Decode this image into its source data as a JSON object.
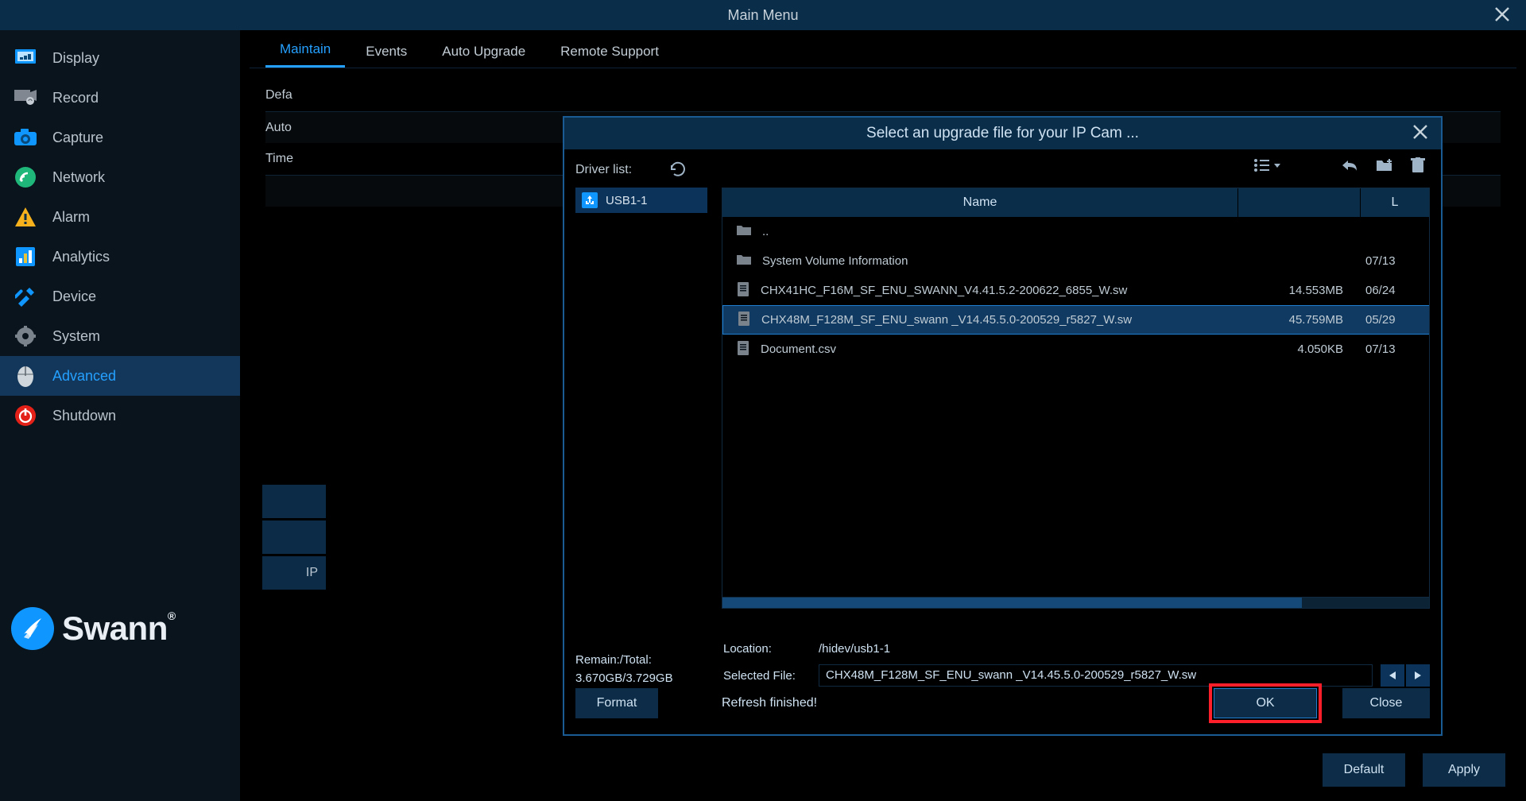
{
  "titlebar": {
    "title": "Main Menu"
  },
  "sidebar": {
    "items": [
      {
        "label": "Display"
      },
      {
        "label": "Record"
      },
      {
        "label": "Capture"
      },
      {
        "label": "Network"
      },
      {
        "label": "Alarm"
      },
      {
        "label": "Analytics"
      },
      {
        "label": "Device"
      },
      {
        "label": "System"
      },
      {
        "label": "Advanced"
      },
      {
        "label": "Shutdown"
      }
    ]
  },
  "brand": {
    "name": "Swann",
    "tm": "®"
  },
  "tabs": [
    {
      "label": "Maintain"
    },
    {
      "label": "Events"
    },
    {
      "label": "Auto Upgrade"
    },
    {
      "label": "Remote Support"
    }
  ],
  "subpage": {
    "row1": "Defa",
    "row2": "Auto",
    "row3": "Time"
  },
  "strips": {
    "ip": "IP"
  },
  "bottom": {
    "default": "Default",
    "apply": "Apply"
  },
  "modal": {
    "title": "Select an upgrade file for your IP Cam ...",
    "driver_label": "Driver list:",
    "drives": [
      {
        "name": "USB1-1"
      }
    ],
    "columns": {
      "name": "Name",
      "date": "L"
    },
    "files": [
      {
        "name": "..",
        "size": "",
        "date": "",
        "icon": "folder"
      },
      {
        "name": "System Volume Information",
        "size": "",
        "date": "07/13",
        "icon": "folder"
      },
      {
        "name": "CHX41HC_F16M_SF_ENU_SWANN_V4.41.5.2-200622_6855_W.sw",
        "size": "14.553MB",
        "date": "06/24",
        "icon": "file"
      },
      {
        "name": "CHX48M_F128M_SF_ENU_swann _V14.45.5.0-200529_r5827_W.sw",
        "size": "45.759MB",
        "date": "05/29",
        "icon": "file",
        "selected": true
      },
      {
        "name": "Document.csv",
        "size": "4.050KB",
        "date": "07/13",
        "icon": "file"
      }
    ],
    "remain_label": "Remain:/Total:",
    "remain_value": "3.670GB/3.729GB",
    "location_label": "Location:",
    "location_value": "/hidev/usb1-1",
    "selected_label": "Selected File:",
    "selected_value": "CHX48M_F128M_SF_ENU_swann _V14.45.5.0-200529_r5827_W.sw",
    "status": "Refresh finished!",
    "format": "Format",
    "ok": "OK",
    "close": "Close"
  }
}
